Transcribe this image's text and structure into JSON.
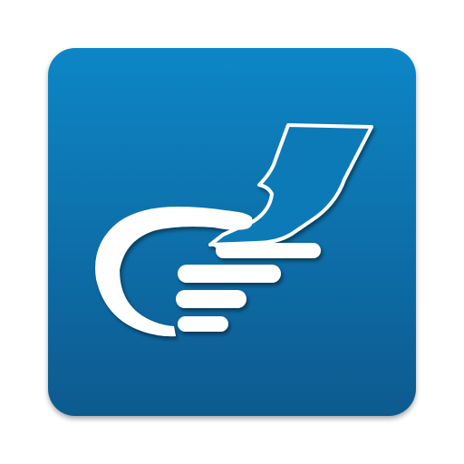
{
  "icon": {
    "semantic": "hand-holding-paper-icon",
    "colors": {
      "tile_top": "#0a86c6",
      "tile_bottom": "#0a5a8f",
      "glyph": "#ffffff",
      "shadow": "#063a5c"
    }
  }
}
